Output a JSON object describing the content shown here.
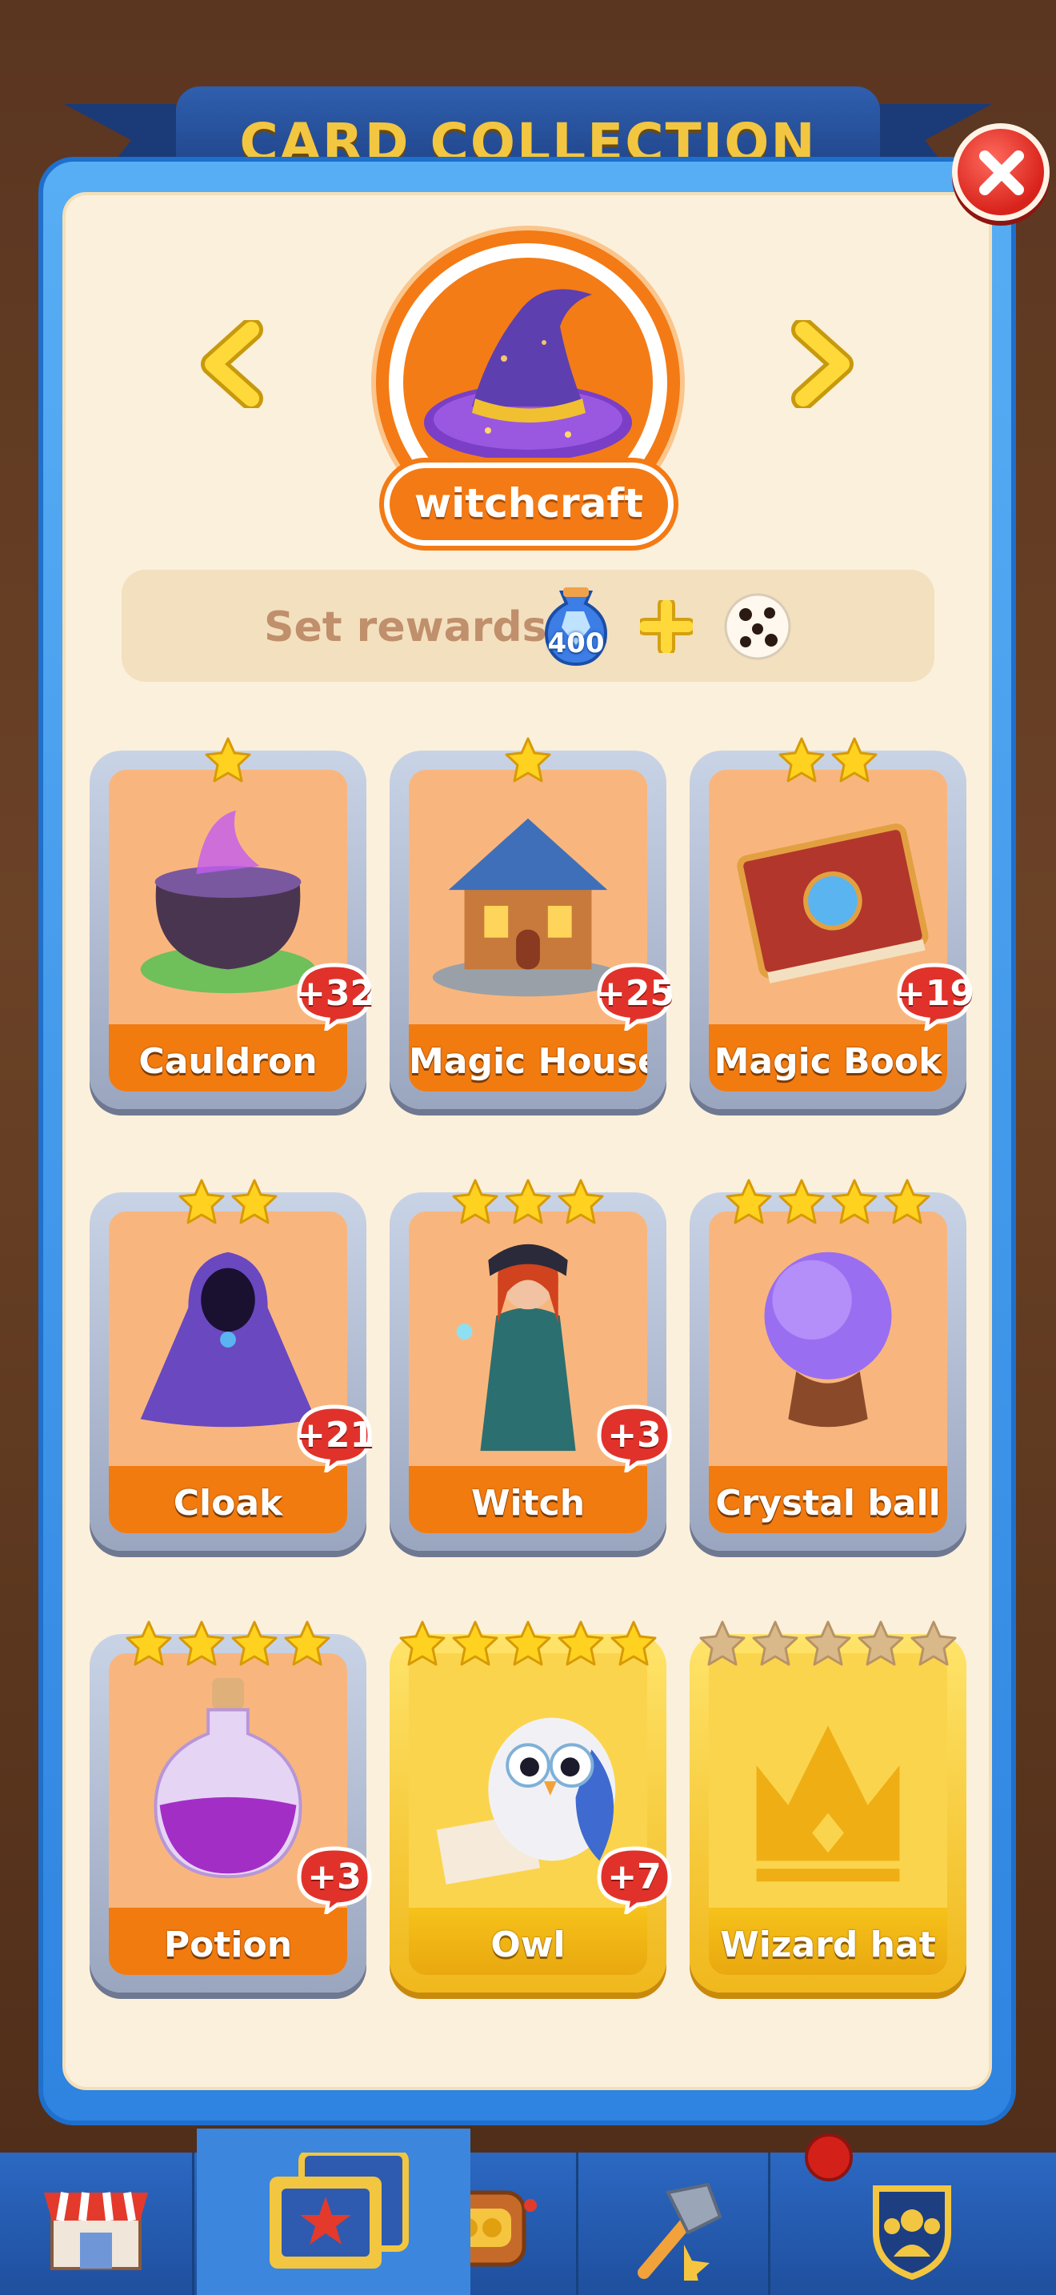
{
  "header": {
    "title": "CARD COLLECTION"
  },
  "set": {
    "name": "witchcraft",
    "rewards_label": "Set rewards",
    "reward_gems": "400",
    "reward_icons": [
      "gem-icon",
      "plus-icon",
      "dice-icon"
    ]
  },
  "cards": [
    {
      "name": "Cauldron",
      "stars": 1,
      "duplicates": "+32",
      "tier": "silver",
      "art": "cauldron-art"
    },
    {
      "name": "Magic House",
      "stars": 1,
      "duplicates": "+25",
      "tier": "silver",
      "art": "house-art"
    },
    {
      "name": "Magic Book",
      "stars": 2,
      "duplicates": "+19",
      "tier": "silver",
      "art": "book-art"
    },
    {
      "name": "Cloak",
      "stars": 2,
      "duplicates": "+21",
      "tier": "silver",
      "art": "cloak-art"
    },
    {
      "name": "Witch",
      "stars": 3,
      "duplicates": "+3",
      "tier": "silver",
      "art": "witch-art"
    },
    {
      "name": "Crystal ball",
      "stars": 4,
      "duplicates": "",
      "tier": "silver",
      "art": "crystal-ball-art"
    },
    {
      "name": "Potion",
      "stars": 4,
      "duplicates": "+3",
      "tier": "silver",
      "art": "potion-art"
    },
    {
      "name": "Owl",
      "stars": 5,
      "duplicates": "+7",
      "tier": "gold",
      "art": "owl-art"
    },
    {
      "name": "Wizard hat",
      "stars": 5,
      "duplicates": "",
      "tier": "gold-locked",
      "art": "crown-placeholder"
    }
  ],
  "bottom_nav": [
    {
      "name": "shop",
      "icon": "shop-icon"
    },
    {
      "name": "cards",
      "icon": "card-album-icon"
    },
    {
      "name": "slots",
      "icon": "slot-machine-icon"
    },
    {
      "name": "build",
      "icon": "hammer-icon"
    },
    {
      "name": "team",
      "icon": "team-shield-icon"
    }
  ],
  "colors": {
    "panel_blue": "#2e84e0",
    "card_orange": "#f27b10",
    "badge_red": "#e0322a",
    "star_yellow": "#ffd21f",
    "gold_frame": "#f0b81c"
  }
}
